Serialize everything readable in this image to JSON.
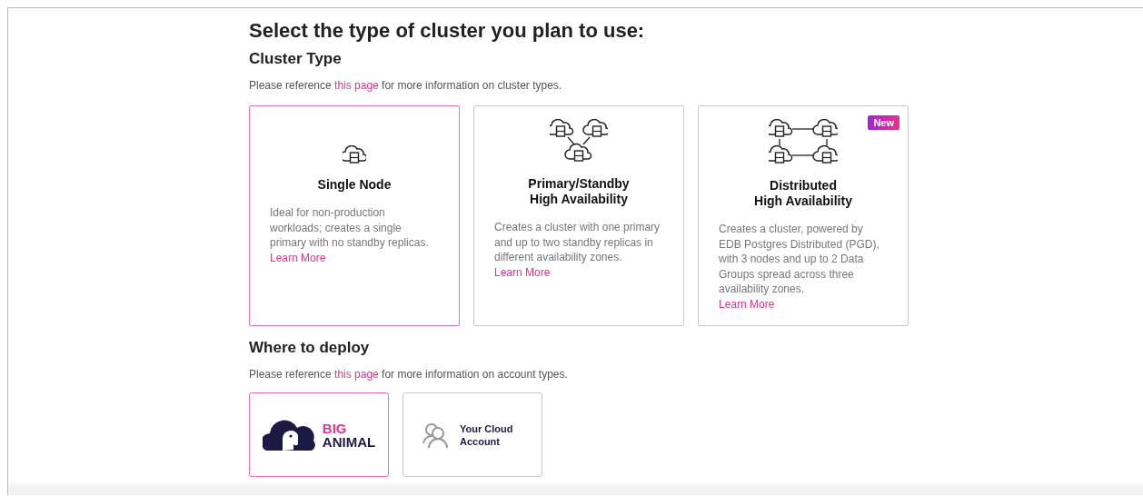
{
  "heading": "Select the type of cluster you plan to use:",
  "cluster_section": {
    "title": "Cluster Type",
    "reference": {
      "before": "Please reference ",
      "link": "this page",
      "after": " for more information on cluster types."
    },
    "options": [
      {
        "kind": "single",
        "title_lines": [
          "Single Node"
        ],
        "description": "Ideal for non-production workloads; creates a single primary with no standby replicas.",
        "link": "Learn More",
        "selected": true
      },
      {
        "kind": "primary_standby",
        "title_lines": [
          "Primary/Standby",
          "High Availability"
        ],
        "description": "Creates a cluster with one primary and up to two standby replicas in different availability zones.",
        "link": "Learn More",
        "selected": false
      },
      {
        "kind": "distributed",
        "title_lines": [
          "Distributed",
          "High Availability"
        ],
        "description": "Creates a cluster, powered by EDB Postgres Distributed (PGD), with 3 nodes and up to 2 Data Groups spread across three availability zones.",
        "link": "Learn More",
        "badge": "New",
        "selected": false
      }
    ]
  },
  "deploy_section": {
    "title": "Where to deploy",
    "reference": {
      "before": "Please reference ",
      "link": "this page",
      "after": " for more information on account types."
    },
    "options": [
      {
        "kind": "biganimal",
        "logo_lines": [
          "BIG",
          "ANIMAL"
        ],
        "selected": true
      },
      {
        "kind": "cloud_account",
        "label": "Your Cloud Account",
        "selected": false
      }
    ]
  }
}
